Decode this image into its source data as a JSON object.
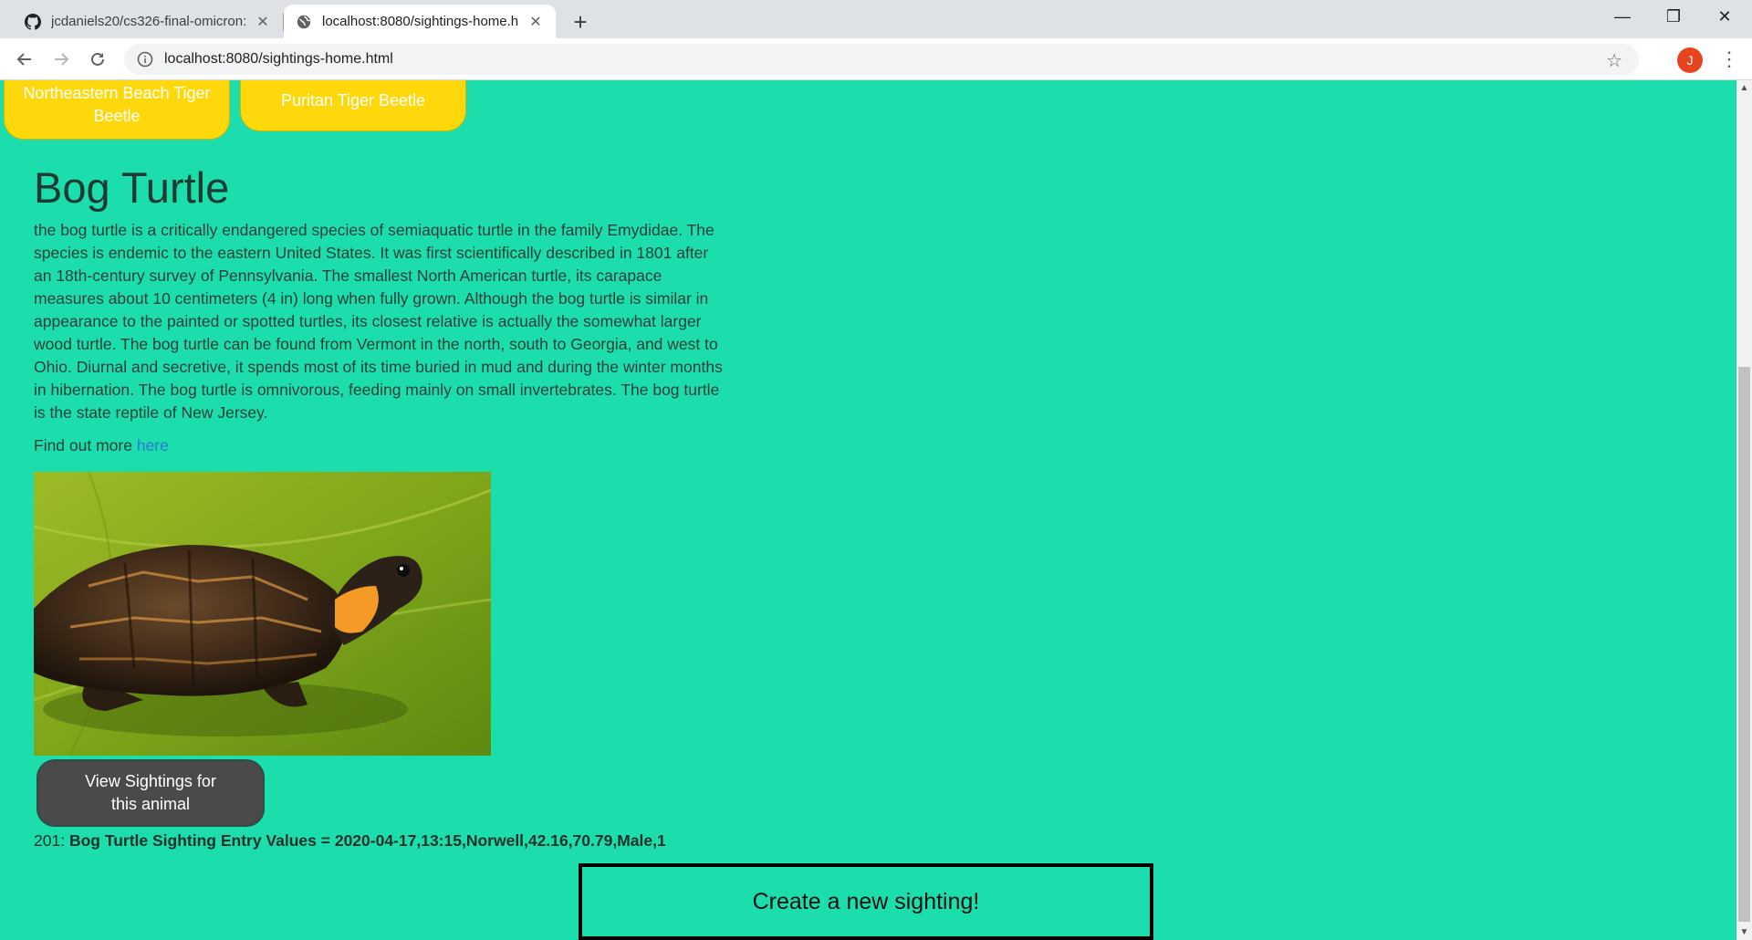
{
  "browser": {
    "tabs": [
      {
        "title": "jcdaniels20/cs326-final-omicron:",
        "icon": "github-icon"
      },
      {
        "title": "localhost:8080/sightings-home.h",
        "icon": "globe-icon",
        "active": true
      }
    ],
    "url": "localhost:8080/sightings-home.html",
    "profile_initial": "J"
  },
  "species_buttons": [
    {
      "label": "Northeastern Beach Tiger Beetle"
    },
    {
      "label": "Puritan Tiger Beetle"
    }
  ],
  "animal": {
    "name": "Bog Turtle",
    "description": "the bog turtle is a critically endangered species of semiaquatic turtle in the family Emydidae. The species is endemic to the eastern United States. It was first scientifically described in 1801 after an 18th-century survey of Pennsylvania. The smallest North American turtle, its carapace measures about 10 centimeters (4 in) long when fully grown. Although the bog turtle is similar in appearance to the painted or spotted turtles, its closest relative is actually the somewhat larger wood turtle. The bog turtle can be found from Vermont in the north, south to Georgia, and west to Ohio. Diurnal and secretive, it spends most of its time buried in mud and during the winter months in hibernation. The bog turtle is omnivorous, feeding mainly on small invertebrates. The bog turtle is the state reptile of New Jersey.",
    "find_out_prefix": "Find out more",
    "find_out_link": "here",
    "view_sightings_label": "View Sightings for this animal"
  },
  "entry": {
    "status": "201:",
    "text": "Bog Turtle Sighting Entry Values = 2020-04-17,13:15,Norwell,42.16,70.79,Male,1"
  },
  "create_button_label": "Create a new sighting!",
  "colors": {
    "page_bg": "#1cdeac",
    "beetle_button": "#ffd80b",
    "sightings_button": "#4a4a4a"
  }
}
